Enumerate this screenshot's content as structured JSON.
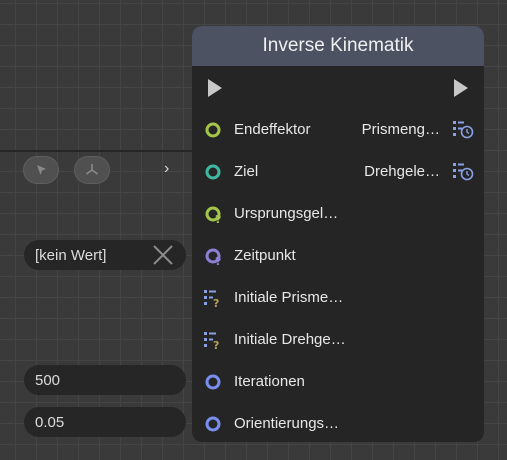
{
  "node": {
    "title": "Inverse Kinematik",
    "inputs": [
      {
        "label": "Endeffektor",
        "icon": "socket-green-icon"
      },
      {
        "label": "Ziel",
        "icon": "socket-teal-icon"
      },
      {
        "label": "Ursprungsgel…",
        "icon": "socket-green-optional-icon"
      },
      {
        "label": "Zeitpunkt",
        "icon": "socket-purple-optional-icon"
      },
      {
        "label": "Initiale Prisme…",
        "icon": "list-optional-icon"
      },
      {
        "label": "Initiale Drehge…",
        "icon": "list-optional-icon"
      },
      {
        "label": "Iterationen",
        "icon": "socket-blue-icon"
      },
      {
        "label": "Orientierungs…",
        "icon": "socket-blue-icon"
      }
    ],
    "outputs": [
      {
        "label": "Prismeng…",
        "icon": "list-clock-icon"
      },
      {
        "label": "Drehgele…",
        "icon": "list-clock-icon"
      }
    ]
  },
  "sidebar": {
    "tools": [
      "cursor-icon",
      "gizmo-icon"
    ],
    "expand_icon": "chevron-right-icon",
    "fields": [
      {
        "value": "[kein Wert]",
        "clearable": true
      },
      {
        "value": "500"
      },
      {
        "value": "0.05"
      }
    ]
  },
  "colors": {
    "header": "#4c5262",
    "node_body": "#252525",
    "socket_green": "#a4c54a",
    "socket_teal": "#3fb8a2",
    "socket_purple": "#8e7fd6",
    "socket_blue": "#7a8ef0",
    "list_icon": "#8aa0e6"
  }
}
